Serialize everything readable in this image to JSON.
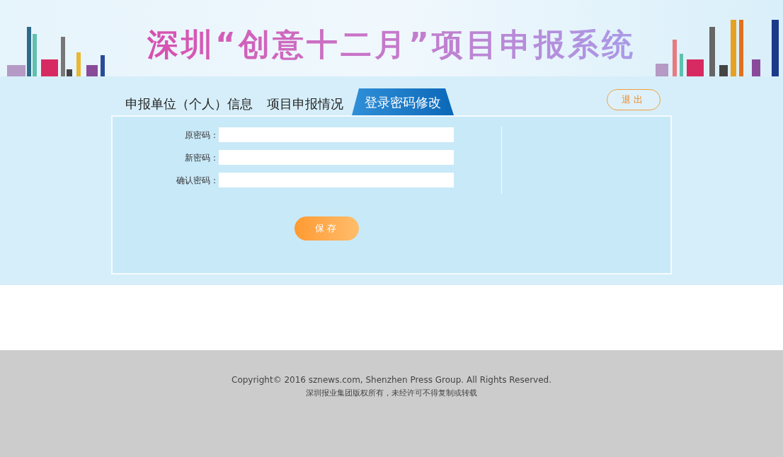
{
  "banner": {
    "title": "深圳“创意十二月”项目申报系统"
  },
  "tabs": [
    {
      "label": "申报单位（个人）信息",
      "selected": false
    },
    {
      "label": "项目申报情况",
      "selected": false
    },
    {
      "label": "登录密码修改",
      "selected": true
    }
  ],
  "logout_button": "退出",
  "form": {
    "fields": [
      {
        "label": "原密码："
      },
      {
        "label": "新密码："
      },
      {
        "label": "确认密码："
      }
    ],
    "save_button": "保存"
  },
  "footer": {
    "copyright": "Copyright© 2016 sznews.com, Shenzhen Press Group. All Rights Reserved.",
    "notice": "深圳报业集团版权所有，未经许可不得复制或转载"
  }
}
